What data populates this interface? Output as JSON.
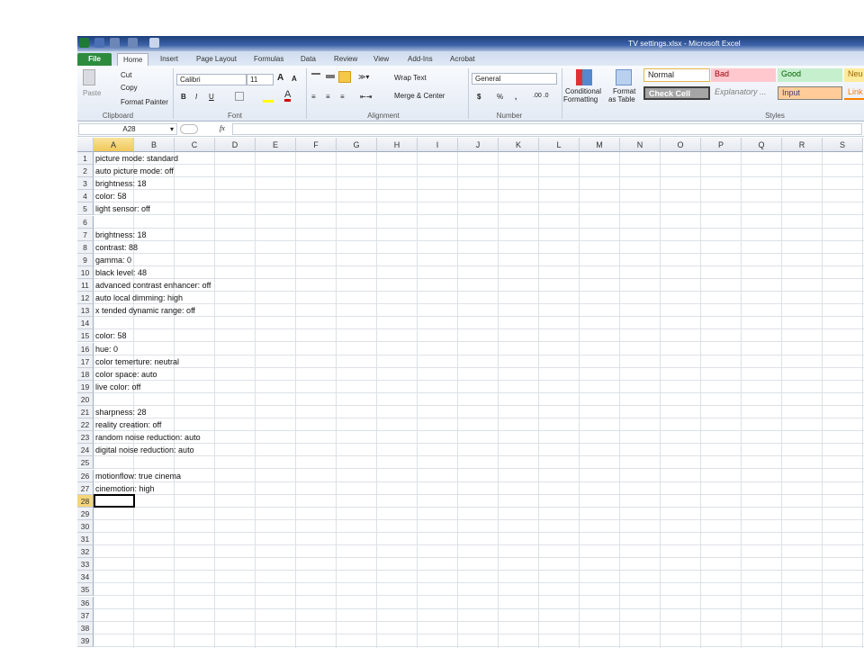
{
  "window": {
    "title": "TV settings.xlsx - Microsoft Excel"
  },
  "tabs": [
    "File",
    "Home",
    "Insert",
    "Page Layout",
    "Formulas",
    "Data",
    "Review",
    "View",
    "Add-Ins",
    "Acrobat"
  ],
  "ribbon": {
    "clipboard": {
      "paste": "Paste",
      "cut": "Cut",
      "copy": "Copy",
      "format_painter": "Format Painter",
      "label": "Clipboard"
    },
    "font": {
      "name": "Calibri",
      "size": "11",
      "bold": "B",
      "italic": "I",
      "underline": "U",
      "label": "Font"
    },
    "alignment": {
      "wrap_text": "Wrap Text",
      "merge_center": "Merge & Center",
      "label": "Alignment"
    },
    "number": {
      "format": "General",
      "currency": "$",
      "percent": "%",
      "comma": ",",
      "label": "Number"
    },
    "styles": {
      "conditional": "Conditional",
      "conditional2": "Formatting",
      "format_table": "Format",
      "format_table2": "as Table",
      "normal": "Normal",
      "bad": "Bad",
      "good": "Good",
      "neutral": "Neu",
      "check_cell": "Check Cell",
      "explanatory": "Explanatory ...",
      "input": "Input",
      "linked": "Link",
      "label": "Styles"
    }
  },
  "formula_bar": {
    "name_box": "A28",
    "fx": "fx",
    "value": ""
  },
  "columns": [
    "A",
    "B",
    "C",
    "D",
    "E",
    "F",
    "G",
    "H",
    "I",
    "J",
    "K",
    "L",
    "M",
    "N",
    "O",
    "P",
    "Q",
    "R",
    "S"
  ],
  "active_cell": {
    "col": "A",
    "row": 28
  },
  "cells": [
    "picture mode: standard",
    "auto picture mode: off",
    "brightness: 18",
    "color: 58",
    "light sensor: off",
    "",
    "brightness: 18",
    "contrast: 88",
    "gamma: 0",
    "black level: 48",
    "advanced contrast enhancer: off",
    "auto local dimming: high",
    "x tended dynamic range: off",
    "",
    "color: 58",
    "hue: 0",
    "color temerture: neutral",
    "color space: auto",
    "live color: off",
    "",
    "sharpness: 28",
    "reality creation: off",
    "random noise reduction: auto",
    "digital noise reduction: auto",
    "",
    "motionflow: true cinema",
    "cinemotion: high"
  ],
  "row_count": 39
}
